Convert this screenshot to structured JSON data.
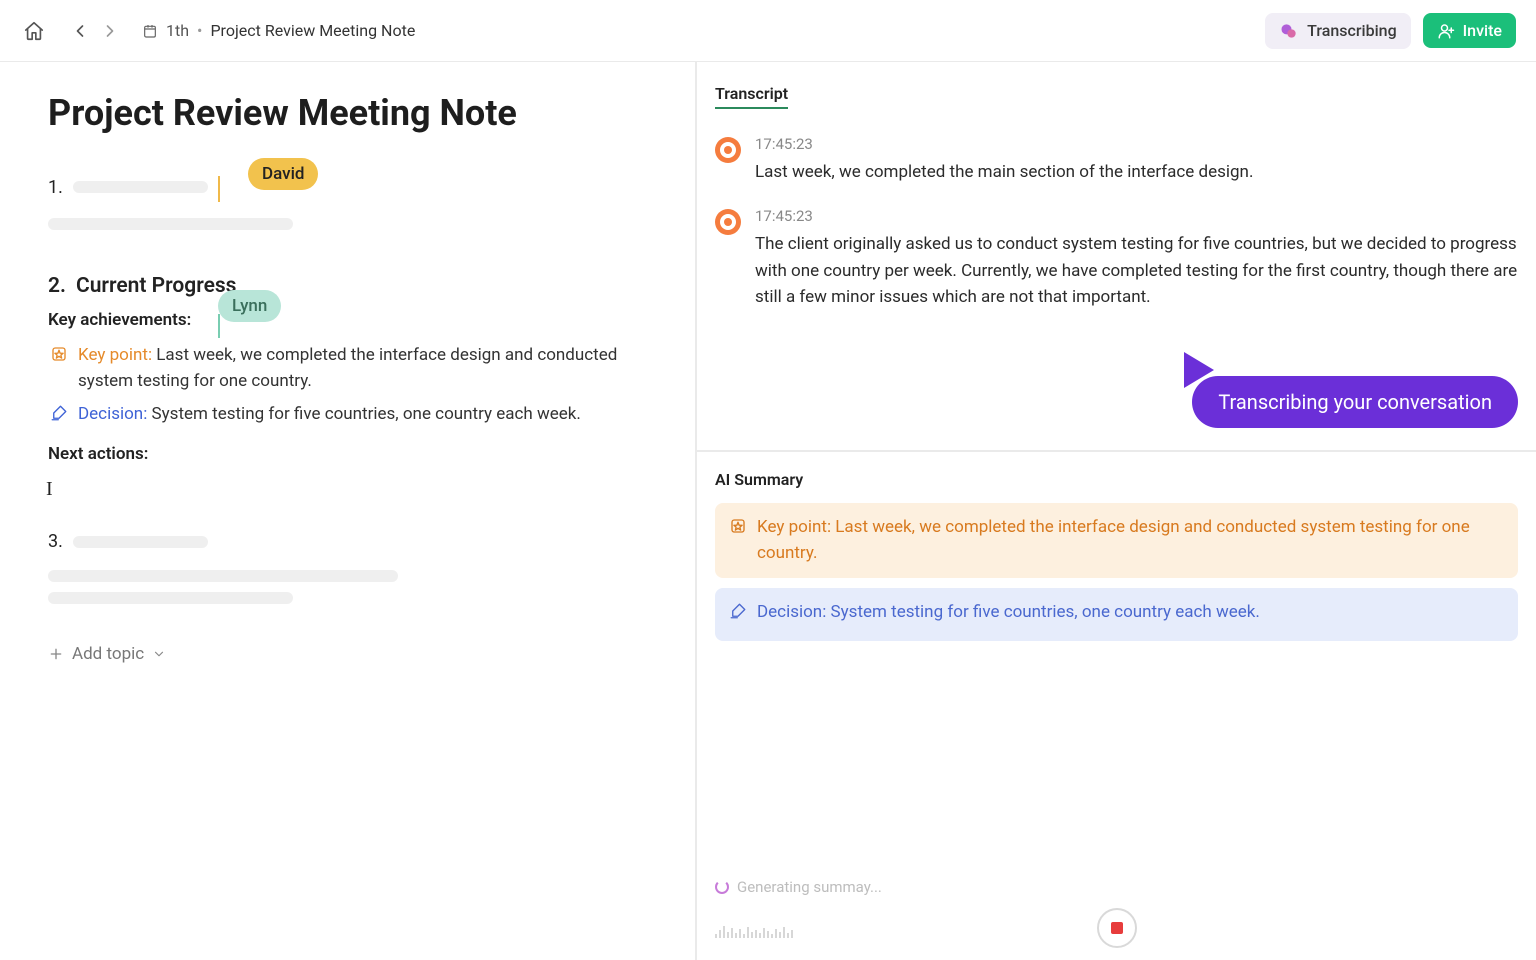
{
  "breadcrumb": {
    "folder": "1th",
    "title": "Project Review Meeting Note"
  },
  "topbar": {
    "transcribing": "Transcribing",
    "invite": "Invite"
  },
  "doc": {
    "title": "Project Review Meeting Note",
    "section1_num": "1.",
    "cursor_user1": "David",
    "section2_num": "2.",
    "section2_title": "Current Progress",
    "key_achievements_label": "Key achievements:",
    "cursor_user2": "Lynn",
    "keypoint_label": "Key point:",
    "keypoint_text": "Last week, we completed the interface design and conducted system testing for one country.",
    "decision_label": "Decision:",
    "decision_text": "System testing for five countries, one country each week.",
    "next_actions_label": "Next actions:",
    "section3_num": "3.",
    "add_topic": "Add topic"
  },
  "transcript": {
    "label": "Transcript",
    "items": [
      {
        "time": "17:45:23",
        "text": "Last week, we completed the main section of the interface design."
      },
      {
        "time": "17:45:23",
        "text": "The client originally asked us to conduct system testing for five countries, but we decided to progress with one country per week. Currently, we have completed testing for the first country, though there are still a few minor issues which are not that important."
      }
    ],
    "callout": "Transcribing your conversation"
  },
  "summary": {
    "label": "AI Summary",
    "keypoint": "Key point: Last week, we completed the interface design and conducted system testing for one country.",
    "decision": "Decision: System testing for five countries, one country each week.",
    "generating": "Generating summay..."
  }
}
